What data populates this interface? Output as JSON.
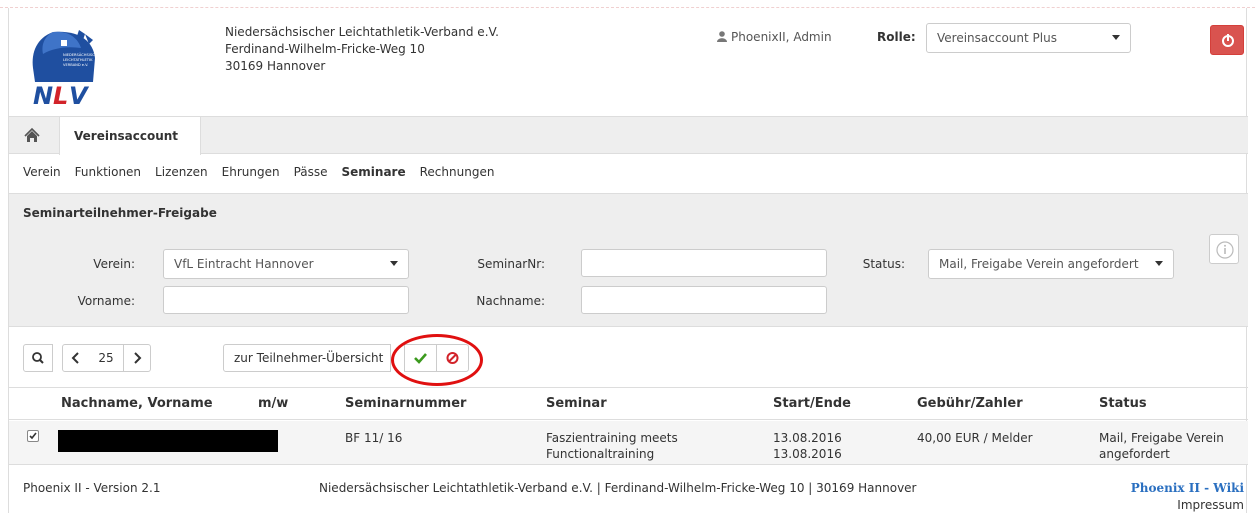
{
  "header": {
    "logo_text": "NLV",
    "logo_subtext": "NIEDERSÄCHSISCHER LEICHTATHLETIK VERBAND e.V.",
    "org_name": "Niedersächsischer Leichtathletik-Verband e.V.",
    "street": "Ferdinand-Wilhelm-Fricke-Weg 10",
    "city": "30169 Hannover",
    "user": "PhoenixII, Admin",
    "rolle_label": "Rolle:",
    "rolle_value": "Vereinsaccount Plus"
  },
  "tabs": {
    "active": "Vereinsaccount"
  },
  "subnav": [
    "Verein",
    "Funktionen",
    "Lizenzen",
    "Ehrungen",
    "Pässe",
    "Seminare",
    "Rechnungen"
  ],
  "filter": {
    "title": "Seminarteilnehmer-Freigabe",
    "verein_label": "Verein:",
    "verein_value": "VfL Eintracht Hannover",
    "seminarnr_label": "SeminarNr:",
    "seminarnr_value": "",
    "status_label": "Status:",
    "status_value": "Mail, Freigabe Verein angefordert",
    "vorname_label": "Vorname:",
    "vorname_value": "",
    "nachname_label": "Nachname:",
    "nachname_value": ""
  },
  "toolbar": {
    "page_size": "25",
    "overview_label": "zur Teilnehmer-Übersicht"
  },
  "table": {
    "headers": [
      "Nachname, Vorname",
      "m/w",
      "Seminarnummer",
      "Seminar",
      "Start/Ende",
      "Gebühr/Zahler",
      "Status"
    ],
    "rows": [
      {
        "checked": true,
        "name": "",
        "mw": "",
        "seminarnummer": "BF 11/ 16",
        "seminar_line1": "Faszientraining meets",
        "seminar_line2": "Functionaltraining",
        "start": "13.08.2016",
        "ende": "13.08.2016",
        "gebuehr": "40,00 EUR / Melder",
        "status_line1": "Mail, Freigabe Verein",
        "status_line2": "angefordert"
      }
    ]
  },
  "footer": {
    "version": "Phoenix II - Version 2.1",
    "center": "Niedersächsischer Leichtathletik-Verband e.V. | Ferdinand-Wilhelm-Fricke-Weg 10 | 30169 Hannover",
    "wiki_link": "Phoenix II - Wiki",
    "impressum": "Impressum"
  },
  "colors": {
    "logo_blue": "#1f4fa0",
    "logo_red": "#d2232a",
    "danger": "#d9534f",
    "success": "#3c9a1e",
    "annotation": "#e01010",
    "link": "#2a6fc0"
  }
}
